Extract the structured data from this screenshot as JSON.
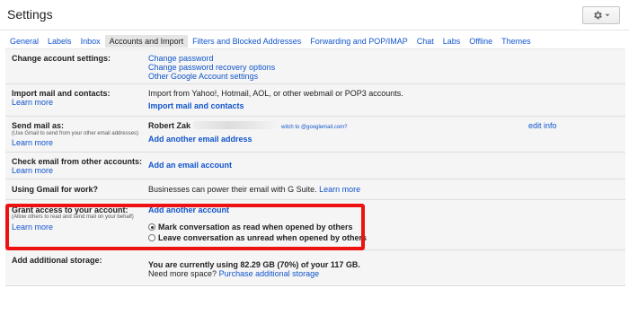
{
  "header": {
    "title": "Settings",
    "gear_icon": "gear-icon"
  },
  "tabs": [
    {
      "label": "General",
      "active": false
    },
    {
      "label": "Labels",
      "active": false
    },
    {
      "label": "Inbox",
      "active": false
    },
    {
      "label": "Accounts and Import",
      "active": true
    },
    {
      "label": "Filters and Blocked Addresses",
      "active": false
    },
    {
      "label": "Forwarding and POP/IMAP",
      "active": false
    },
    {
      "label": "Chat",
      "active": false
    },
    {
      "label": "Labs",
      "active": false
    },
    {
      "label": "Offline",
      "active": false
    },
    {
      "label": "Themes",
      "active": false
    }
  ],
  "rows": {
    "change_account": {
      "label": "Change account settings:",
      "links": [
        "Change password",
        "Change password recovery options",
        "Other Google Account settings"
      ]
    },
    "import": {
      "label": "Import mail and contacts:",
      "learn_more": "Learn more",
      "description": "Import from Yahoo!, Hotmail, AOL, or other webmail or POP3 accounts.",
      "action": "Import mail and contacts"
    },
    "send_as": {
      "label": "Send mail as:",
      "sub": "(Use Gmail to send from your other email addresses)",
      "learn_more": "Learn more",
      "name": "Robert Zak",
      "switch_text": "witch to @googlemail.com?",
      "edit": "edit info",
      "action": "Add another email address"
    },
    "check_email": {
      "label": "Check email from other accounts:",
      "learn_more": "Learn more",
      "action": "Add an email account"
    },
    "work": {
      "label": "Using Gmail for work?",
      "description": "Businesses can power their email with G Suite.",
      "learn_more": "Learn more"
    },
    "grant": {
      "label": "Grant access to your account:",
      "sub": "(Allow others to read and send mail on your behalf)",
      "learn_more": "Learn more",
      "action": "Add another account",
      "option_read": "Mark conversation as read when opened by others",
      "option_unread": "Leave conversation as unread when opened by others",
      "selected": "read"
    },
    "storage": {
      "label": "Add additional storage:",
      "usage": "You are currently using 82.29 GB (70%) of your 117 GB.",
      "need_more": "Need more space?",
      "purchase": "Purchase additional storage"
    }
  },
  "colors": {
    "link": "#1155cc",
    "highlight": "#ee1111",
    "row_bg": "#f5f5f5"
  }
}
